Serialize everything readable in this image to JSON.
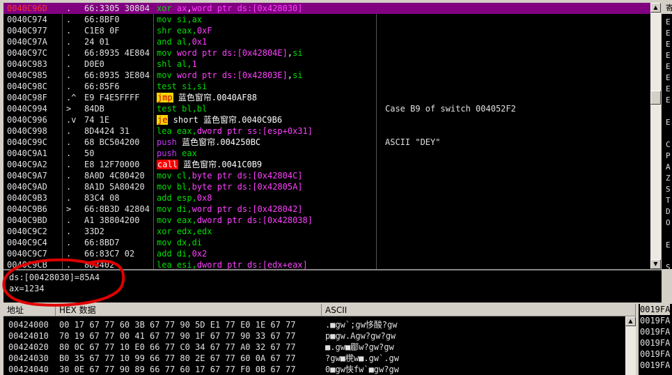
{
  "cpu": {
    "rows": [
      {
        "addr": "0040C96D",
        "flag": ".",
        "hex": "66:3305 30804",
        "asm": [
          [
            "mn",
            "xor "
          ],
          [
            "reg",
            "ax"
          ],
          [
            "plain",
            ","
          ],
          [
            "reg",
            "word ptr ds:[0x428030]"
          ]
        ],
        "comment": "",
        "selected": true
      },
      {
        "addr": "0040C974",
        "flag": ".",
        "hex": "66:8BF0",
        "asm": [
          [
            "mn",
            "mov "
          ],
          [
            "mn",
            "si,ax"
          ]
        ],
        "comment": ""
      },
      {
        "addr": "0040C977",
        "flag": ".",
        "hex": "C1E8 0F",
        "asm": [
          [
            "mn",
            "shr "
          ],
          [
            "mn",
            "eax,"
          ],
          [
            "hex",
            "0xF"
          ]
        ],
        "comment": ""
      },
      {
        "addr": "0040C97A",
        "flag": ".",
        "hex": "24 01",
        "asm": [
          [
            "mn",
            "and "
          ],
          [
            "mn",
            "al,"
          ],
          [
            "hex",
            "0x1"
          ]
        ],
        "comment": ""
      },
      {
        "addr": "0040C97C",
        "flag": ".",
        "hex": "66:8935 4E804",
        "asm": [
          [
            "mn",
            "mov "
          ],
          [
            "reg",
            "word ptr ds:[0x42804E]"
          ],
          [
            "plain",
            ","
          ],
          [
            "mn",
            "si"
          ]
        ],
        "comment": ""
      },
      {
        "addr": "0040C983",
        "flag": ".",
        "hex": "D0E0",
        "asm": [
          [
            "mn",
            "shl "
          ],
          [
            "mn",
            "al,"
          ],
          [
            "hex",
            "1"
          ]
        ],
        "comment": ""
      },
      {
        "addr": "0040C985",
        "flag": ".",
        "hex": "66:8935 3E804",
        "asm": [
          [
            "mn",
            "mov "
          ],
          [
            "reg",
            "word ptr ds:[0x42803E]"
          ],
          [
            "plain",
            ","
          ],
          [
            "mn",
            "si"
          ]
        ],
        "comment": ""
      },
      {
        "addr": "0040C98C",
        "flag": ".",
        "hex": "66:85F6",
        "asm": [
          [
            "mn",
            "test "
          ],
          [
            "mn",
            "si,si"
          ]
        ],
        "comment": ""
      },
      {
        "addr": "0040C98F",
        "flag": ".^",
        "hex": "E9 F4E5FFFF",
        "asm": [
          [
            "jmp",
            "jmp"
          ],
          [
            "plain",
            " 蓝色窗帘.0040AF88"
          ]
        ],
        "comment": ""
      },
      {
        "addr": "0040C994",
        "flag": ">",
        "hex": "84DB",
        "asm": [
          [
            "mn",
            "test "
          ],
          [
            "mn",
            "bl,bl"
          ]
        ],
        "comment": "Case B9 of switch 004052F2"
      },
      {
        "addr": "0040C996",
        "flag": ".v",
        "hex": "74 1E",
        "asm": [
          [
            "jmp",
            "je"
          ],
          [
            "plain",
            " short 蓝色窗帘.0040C9B6"
          ]
        ],
        "comment": ""
      },
      {
        "addr": "0040C998",
        "flag": ".",
        "hex": "8D4424 31",
        "asm": [
          [
            "mn",
            "lea "
          ],
          [
            "mn",
            "eax,"
          ],
          [
            "reg",
            "dword ptr ss:[esp+0x31]"
          ]
        ],
        "comment": ""
      },
      {
        "addr": "0040C99C",
        "flag": ".",
        "hex": "68 BC504200",
        "asm": [
          [
            "push",
            "push"
          ],
          [
            "plain",
            " 蓝色窗帘.004250BC"
          ]
        ],
        "comment": "ASCII \"DEY\""
      },
      {
        "addr": "0040C9A1",
        "flag": ".",
        "hex": "50",
        "asm": [
          [
            "push",
            "push "
          ],
          [
            "mn",
            "eax"
          ]
        ],
        "comment": ""
      },
      {
        "addr": "0040C9A2",
        "flag": ".",
        "hex": "E8 12F70000",
        "asm": [
          [
            "call",
            "call"
          ],
          [
            "plain",
            " 蓝色窗帘.0041C0B9"
          ]
        ],
        "comment": ""
      },
      {
        "addr": "0040C9A7",
        "flag": ".",
        "hex": "8A0D 4C80420",
        "asm": [
          [
            "mn",
            "mov "
          ],
          [
            "mn",
            "cl,"
          ],
          [
            "reg",
            "byte ptr ds:[0x42804C]"
          ]
        ],
        "comment": ""
      },
      {
        "addr": "0040C9AD",
        "flag": ".",
        "hex": "8A1D 5A80420",
        "asm": [
          [
            "mn",
            "mov "
          ],
          [
            "mn",
            "bl,"
          ],
          [
            "reg",
            "byte ptr ds:[0x42805A]"
          ]
        ],
        "comment": ""
      },
      {
        "addr": "0040C9B3",
        "flag": ".",
        "hex": "83C4 08",
        "asm": [
          [
            "mn",
            "add "
          ],
          [
            "mn",
            "esp,"
          ],
          [
            "hex",
            "0x8"
          ]
        ],
        "comment": ""
      },
      {
        "addr": "0040C9B6",
        "flag": ">",
        "hex": "66:8B3D 42804",
        "asm": [
          [
            "mn",
            "mov "
          ],
          [
            "mn",
            "di,"
          ],
          [
            "reg",
            "word ptr ds:[0x428042]"
          ]
        ],
        "comment": ""
      },
      {
        "addr": "0040C9BD",
        "flag": ".",
        "hex": "A1 38804200",
        "asm": [
          [
            "mn",
            "mov "
          ],
          [
            "mn",
            "eax,"
          ],
          [
            "reg",
            "dword ptr ds:[0x428038]"
          ]
        ],
        "comment": ""
      },
      {
        "addr": "0040C9C2",
        "flag": ".",
        "hex": "33D2",
        "asm": [
          [
            "mn",
            "xor "
          ],
          [
            "mn",
            "edx,edx"
          ]
        ],
        "comment": ""
      },
      {
        "addr": "0040C9C4",
        "flag": ".",
        "hex": "66:8BD7",
        "asm": [
          [
            "mn",
            "mov "
          ],
          [
            "mn",
            "dx,di"
          ]
        ],
        "comment": ""
      },
      {
        "addr": "0040C9C7",
        "flag": ".",
        "hex": "66:83C7 02",
        "asm": [
          [
            "mn",
            "add "
          ],
          [
            "mn",
            "di,"
          ],
          [
            "hex",
            "0x2"
          ]
        ],
        "comment": ""
      },
      {
        "addr": "0040C9CB",
        "flag": ".",
        "hex": "8D3402",
        "asm": [
          [
            "mn",
            "lea "
          ],
          [
            "mn",
            "esi,"
          ],
          [
            "reg",
            "dword ptr ds:[edx+eax]"
          ]
        ],
        "comment": ""
      }
    ]
  },
  "registers_header": "寄",
  "register_letters": [
    "E",
    "E",
    "E",
    "E",
    "E",
    "E",
    "E",
    "E",
    "",
    "E",
    "",
    "C",
    "P",
    "A",
    "Z",
    "S",
    "T",
    "D",
    "O",
    "",
    "E",
    "",
    "S",
    "S",
    "S"
  ],
  "info": {
    "line1": "ds:[00428030]=85A4",
    "line2": "ax=1234"
  },
  "dump": {
    "headers": {
      "address": "地址",
      "hex": "HEX 数据",
      "ascii": "ASCII"
    },
    "rows": [
      {
        "addr": "00424000",
        "hex": "00 17 67 77 60 3B 67 77 90 5D E1 77 E0 1E 67 77",
        "ascii": ".■gw`;gw恀酸?gw"
      },
      {
        "addr": "00424010",
        "hex": "70 19 67 77 00 41 67 77 90 1F 67 77 90 33 67 77",
        "ascii": "p■gw.Agw?gw?gw"
      },
      {
        "addr": "00424020",
        "hex": "80 0C 67 77 10 E0 66 77 C0 34 67 77 A0 32 67 77",
        "ascii": "■.gw■郿w?gw?gw"
      },
      {
        "addr": "00424030",
        "hex": "B0 35 67 77 10 99 66 77 80 2E 67 77 60 0A 67 77",
        "ascii": "?gw■櫈w■.gw`.gw"
      },
      {
        "addr": "00424040",
        "hex": "30 0E 67 77 90 89 66 77 60 17 67 77 F0 0B 67 77",
        "ascii": "0■gw悏fw`■gw?gw"
      }
    ]
  },
  "stack": {
    "rows": [
      "0019FA",
      "0019FA",
      "0019FA",
      "0019FA",
      "0019FA",
      "0019FA"
    ]
  },
  "colors": {
    "selected_row": "#800080",
    "mnemonic": "#00e000",
    "operand": "#ff40ff",
    "jump_bg": "#ffd700",
    "call_bg": "#ff0000",
    "annotation": "#e00000"
  }
}
